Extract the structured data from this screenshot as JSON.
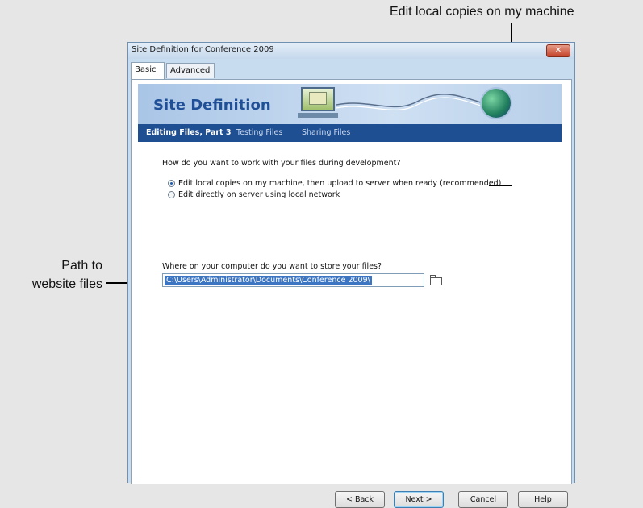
{
  "annotations": {
    "top_callout": "Edit local copies on my machine",
    "left_callout_line1": "Path to",
    "left_callout_line2": "website files"
  },
  "dialog": {
    "title": "Site Definition for Conference 2009",
    "close_glyph": "✕",
    "tabs": [
      {
        "label": "Basic",
        "active": true
      },
      {
        "label": "Advanced",
        "active": false
      }
    ],
    "banner_title": "Site Definition",
    "steps": [
      {
        "label": "Editing Files, Part 3",
        "current": true
      },
      {
        "label": "Testing Files",
        "current": false
      },
      {
        "label": "Sharing Files",
        "current": false
      }
    ],
    "question": "How do you want to work with your files during development?",
    "options": [
      {
        "label": "Edit local copies on my machine, then upload to server when ready (recommended)",
        "selected": true
      },
      {
        "label": "Edit directly on server using local network",
        "selected": false
      }
    ],
    "path_question": "Where on your computer do you want to store your files?",
    "path_value": "C:\\Users\\Administrator\\Documents\\Conference 2009\\",
    "folder_icon": "folder-icon",
    "buttons": {
      "back": "< Back",
      "next": "Next >",
      "cancel": "Cancel",
      "help": "Help"
    }
  },
  "colors": {
    "step_bar": "#1f4f93",
    "banner_title": "#1f4f96",
    "selection": "#3c75c2"
  }
}
